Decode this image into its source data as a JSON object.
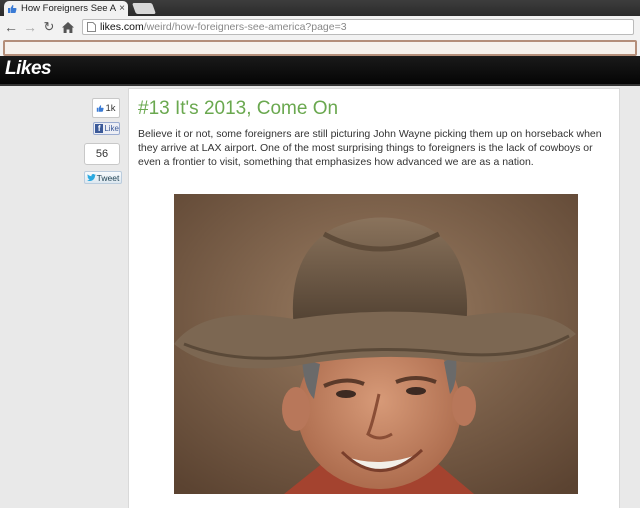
{
  "browser": {
    "tab_title": "How Foreigners See Ameri",
    "tab_close": "×",
    "nav_back": "←",
    "nav_forward": "→",
    "nav_reload": "↻",
    "url_domain": "likes.com",
    "url_path": "/weird/how-foreigners-see-america?page=3"
  },
  "site": {
    "logo": "Likes"
  },
  "share": {
    "like_count": "1k",
    "fb_like_label": "Like",
    "tweet_count": "56",
    "tweet_label": "Tweet"
  },
  "article": {
    "title": "#13 It's 2013, Come On",
    "body": "Believe it or not, some foreigners are still picturing John Wayne picking them up on horseback when they arrive at LAX airport. One of the most surprising things to foreigners is the lack of cowboys or even a frontier to visit, something that emphasizes how advanced we are as a nation."
  },
  "colors": {
    "title_green": "#6aa84f",
    "facebook_blue": "#3b5998",
    "header_black": "#0a0a0a"
  }
}
